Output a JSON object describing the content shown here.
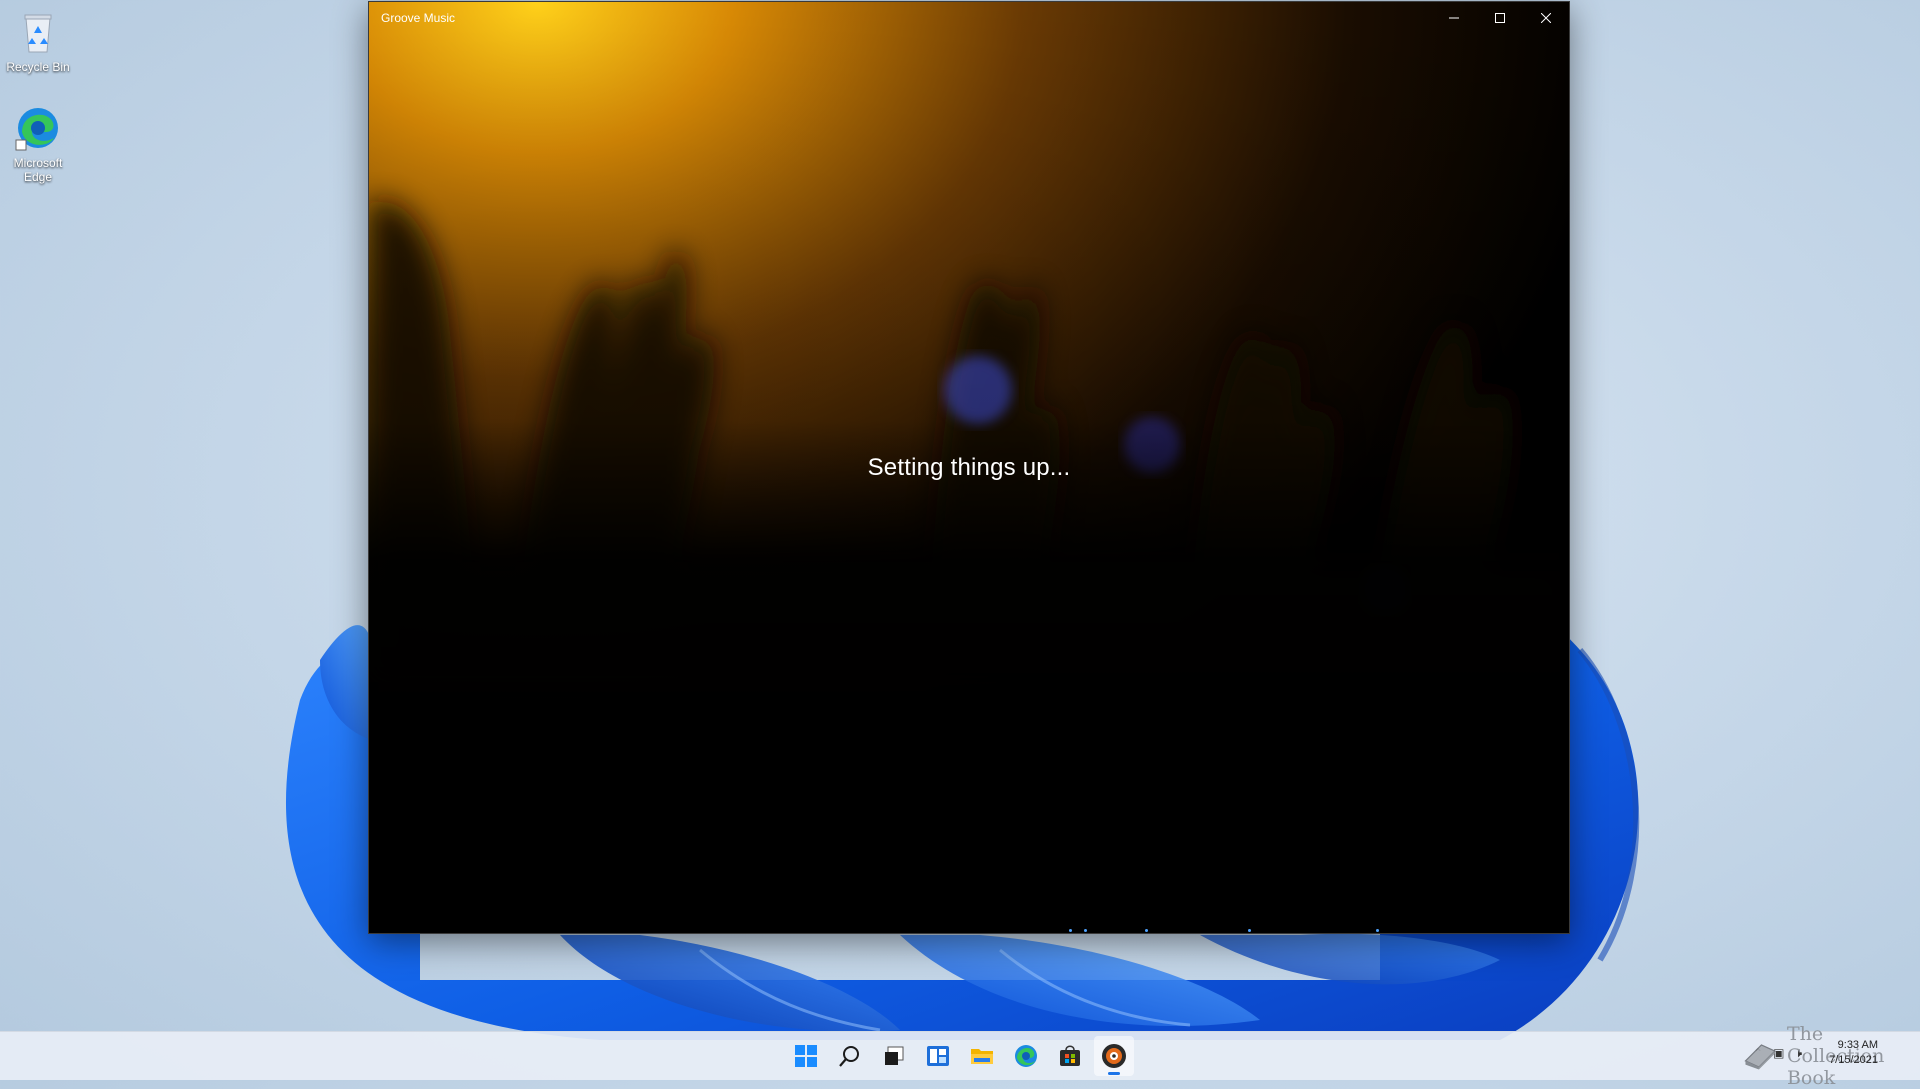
{
  "desktop": {
    "icons": [
      {
        "label": "Recycle Bin",
        "icon": "recycle-bin-icon"
      },
      {
        "label": "Microsoft Edge",
        "icon": "edge-icon"
      }
    ]
  },
  "window": {
    "title": "Groove Music",
    "status": "Setting things up...",
    "controls": {
      "minimize": "minimize-icon",
      "maximize": "maximize-icon",
      "close": "close-icon"
    }
  },
  "taskbar": {
    "apps": [
      {
        "name": "Start",
        "icon": "windows-start-icon",
        "active": false
      },
      {
        "name": "Search",
        "icon": "search-icon",
        "active": false
      },
      {
        "name": "Task View",
        "icon": "task-view-icon",
        "active": false
      },
      {
        "name": "Widgets",
        "icon": "widgets-icon",
        "active": false
      },
      {
        "name": "File Explorer",
        "icon": "folder-icon",
        "active": false
      },
      {
        "name": "Microsoft Edge",
        "icon": "edge-icon",
        "active": false
      },
      {
        "name": "Microsoft Store",
        "icon": "store-icon",
        "active": false
      },
      {
        "name": "Groove Music",
        "icon": "groove-music-icon",
        "active": true
      }
    ],
    "tray": {
      "time": "9:33 AM",
      "date": "7/15/2021",
      "watermark": "The Collection Book"
    }
  },
  "colors": {
    "accent": "#1a73e8",
    "window_bg": "#000000",
    "glow": "#f0a10a"
  }
}
